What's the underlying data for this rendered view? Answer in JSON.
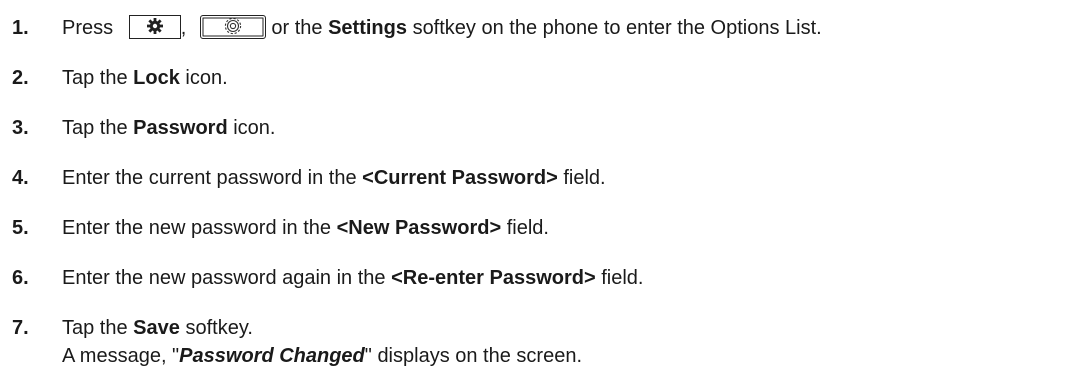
{
  "steps": [
    {
      "num": "1.",
      "pre": "Press",
      "comma": ",",
      "mid": "or the",
      "bold": "Settings",
      "post": "softkey on the phone to enter the Options List.",
      "icons": [
        "settings-key-icon",
        "settings-softkey-icon"
      ]
    },
    {
      "num": "2.",
      "pre": "Tap the",
      "bold": "Lock",
      "post": "icon."
    },
    {
      "num": "3.",
      "pre": "Tap the",
      "bold": "Password",
      "post": "icon."
    },
    {
      "num": "4.",
      "pre": "Enter the current password in the",
      "bold": "<Current Password>",
      "post": "field."
    },
    {
      "num": "5.",
      "pre": "Enter the new password in the",
      "bold": "<New Password>",
      "post": "field."
    },
    {
      "num": "6.",
      "pre": "Enter the new password again in the",
      "bold": "<Re-enter Password>",
      "post": "field."
    },
    {
      "num": "7.",
      "pre": "Tap the",
      "bold": "Save",
      "post": "softkey.",
      "line2_pre": "A message, \"",
      "line2_bold": "Password Changed",
      "line2_post": "\" displays on the screen."
    }
  ]
}
